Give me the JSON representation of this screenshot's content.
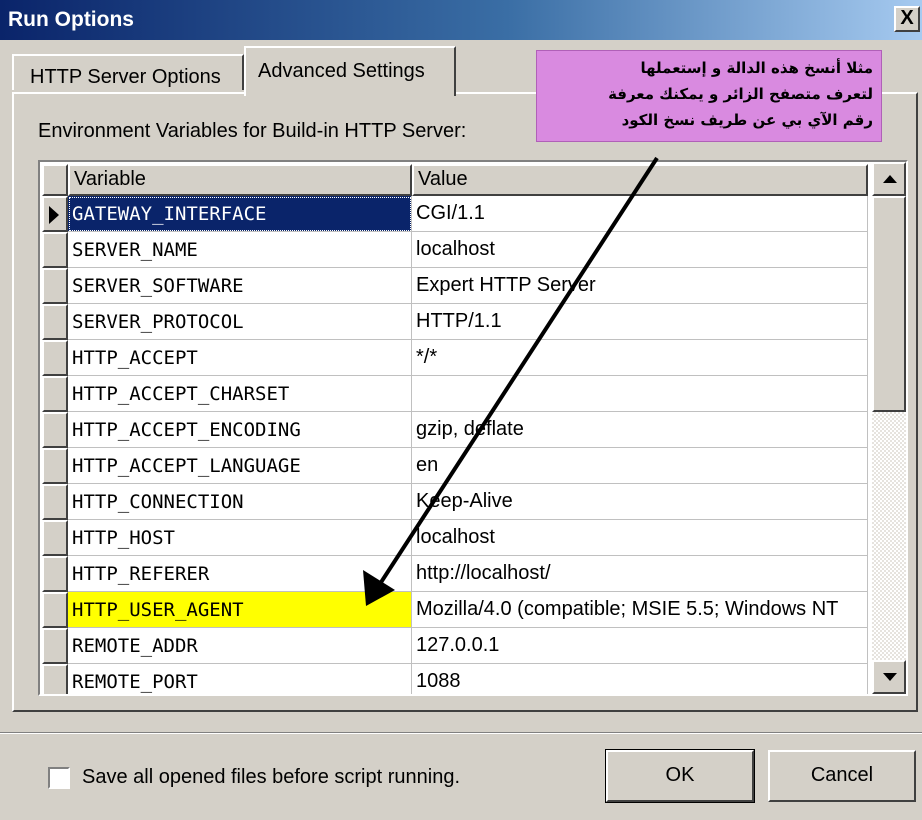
{
  "window": {
    "title": "Run Options",
    "close_glyph": "X"
  },
  "tabs": [
    {
      "label": "HTTP Server Options",
      "active": false
    },
    {
      "label": "Advanced Settings",
      "active": true
    }
  ],
  "env_label": "Environment Variables for Build-in HTTP Server:",
  "grid": {
    "columns": [
      "Variable",
      "Value"
    ],
    "rows": [
      {
        "variable": "GATEWAY_INTERFACE",
        "value": "CGI/1.1"
      },
      {
        "variable": "SERVER_NAME",
        "value": "localhost"
      },
      {
        "variable": "SERVER_SOFTWARE",
        "value": "Expert HTTP Server"
      },
      {
        "variable": "SERVER_PROTOCOL",
        "value": "HTTP/1.1"
      },
      {
        "variable": "HTTP_ACCEPT",
        "value": "*/*"
      },
      {
        "variable": "HTTP_ACCEPT_CHARSET",
        "value": ""
      },
      {
        "variable": "HTTP_ACCEPT_ENCODING",
        "value": "gzip, deflate"
      },
      {
        "variable": "HTTP_ACCEPT_LANGUAGE",
        "value": "en"
      },
      {
        "variable": "HTTP_CONNECTION",
        "value": "Keep-Alive"
      },
      {
        "variable": "HTTP_HOST",
        "value": "localhost"
      },
      {
        "variable": "HTTP_REFERER",
        "value": "http://localhost/"
      },
      {
        "variable": "HTTP_USER_AGENT",
        "value": "Mozilla/4.0 (compatible; MSIE 5.5; Windows NT"
      },
      {
        "variable": "REMOTE_ADDR",
        "value": "127.0.0.1"
      },
      {
        "variable": "REMOTE_PORT",
        "value": "1088"
      }
    ]
  },
  "annotation": {
    "lines": [
      "مثلا أنسخ هذه الدالة و إستعملها",
      "لتعرف متصفح الزائر و يمكنك معرفة",
      "رقم الآي بي عن طريف نسخ الكود"
    ],
    "color": "#d98ae0"
  },
  "checkbox": {
    "label": "Save all opened files before script running.",
    "checked": false
  },
  "buttons": {
    "ok": "OK",
    "cancel": "Cancel"
  },
  "colors": {
    "titlebar": "#0a246a",
    "highlight": "#ffff00",
    "selected": "#0a246a"
  }
}
